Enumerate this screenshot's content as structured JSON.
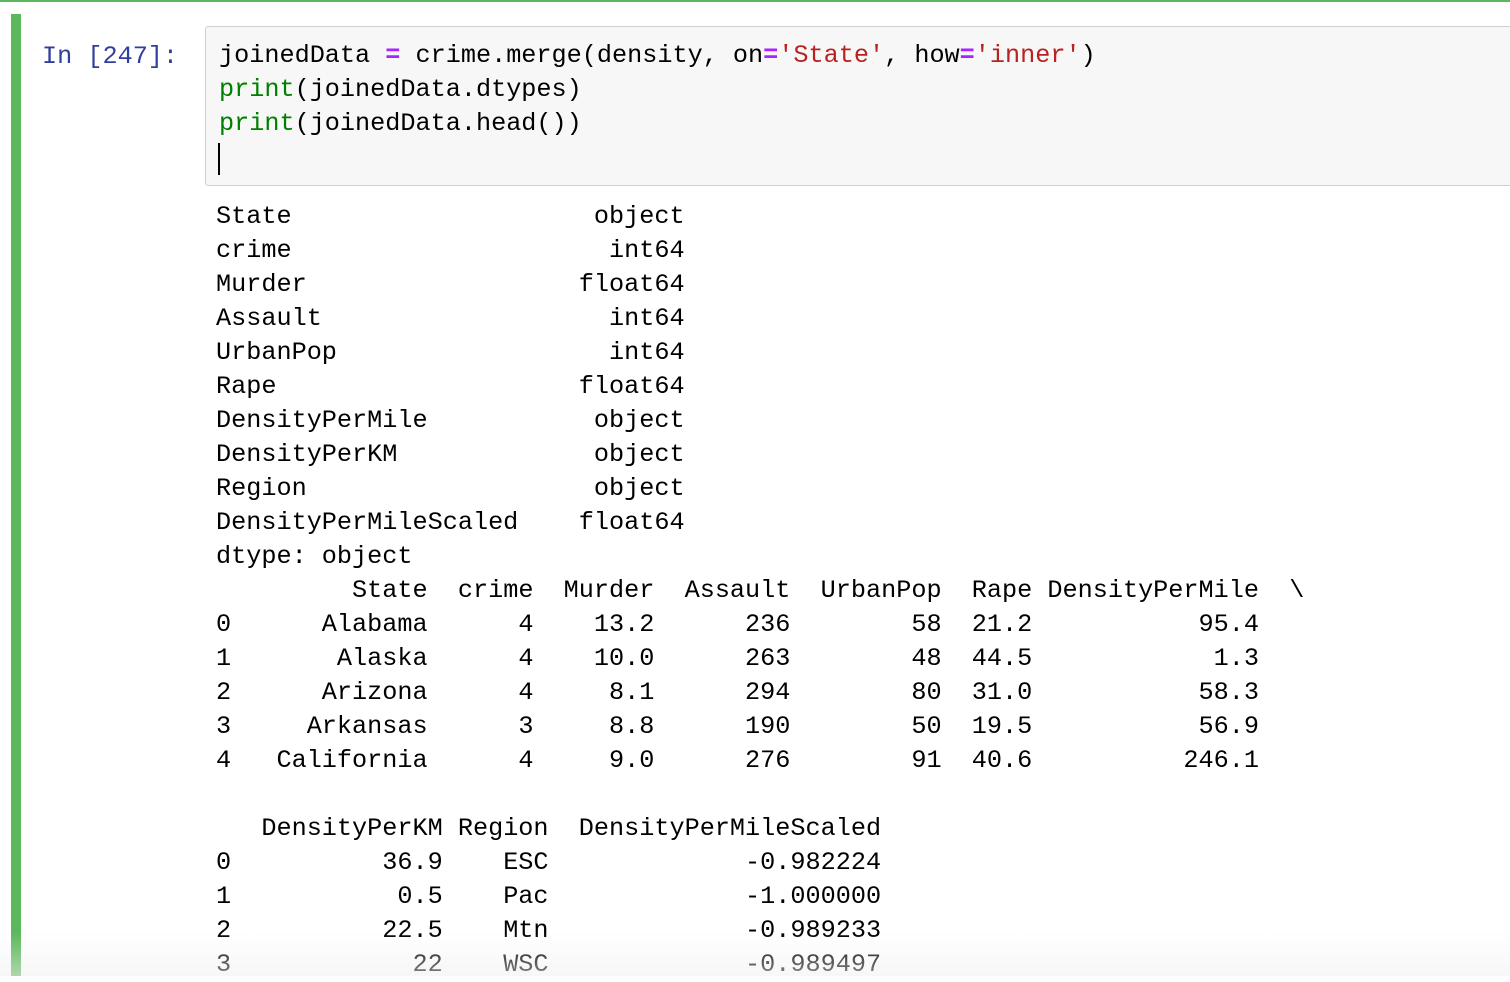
{
  "cell": {
    "prompt": "In [247]:",
    "code_lines": [
      [
        {
          "t": "joinedData ",
          "k": "plain"
        },
        {
          "t": "=",
          "k": "op"
        },
        {
          "t": " crime.merge(density, on",
          "k": "plain"
        },
        {
          "t": "=",
          "k": "op"
        },
        {
          "t": "'State'",
          "k": "str"
        },
        {
          "t": ", how",
          "k": "plain"
        },
        {
          "t": "=",
          "k": "op"
        },
        {
          "t": "'inner'",
          "k": "str"
        },
        {
          "t": ")",
          "k": "plain"
        }
      ],
      [
        {
          "t": "print",
          "k": "fn"
        },
        {
          "t": "(joinedData.dtypes)",
          "k": "plain"
        }
      ],
      [
        {
          "t": "print",
          "k": "fn"
        },
        {
          "t": "(joinedData.head())",
          "k": "plain"
        }
      ]
    ]
  },
  "output": {
    "dtypes": [
      {
        "name": "State",
        "dtype": "object"
      },
      {
        "name": "crime",
        "dtype": "int64"
      },
      {
        "name": "Murder",
        "dtype": "float64"
      },
      {
        "name": "Assault",
        "dtype": "int64"
      },
      {
        "name": "UrbanPop",
        "dtype": "int64"
      },
      {
        "name": "Rape",
        "dtype": "float64"
      },
      {
        "name": "DensityPerMile",
        "dtype": "object"
      },
      {
        "name": "DensityPerKM",
        "dtype": "object"
      },
      {
        "name": "Region",
        "dtype": "object"
      },
      {
        "name": "DensityPerMileScaled",
        "dtype": "float64"
      }
    ],
    "dtype_footer": "dtype: object",
    "table1": {
      "columns": [
        "State",
        "crime",
        "Murder",
        "Assault",
        "UrbanPop",
        "Rape",
        "DensityPerMile"
      ],
      "continuation": "\\",
      "rows": [
        {
          "index": "0",
          "cells": [
            "Alabama",
            "4",
            "13.2",
            "236",
            "58",
            "21.2",
            "95.4"
          ]
        },
        {
          "index": "1",
          "cells": [
            "Alaska",
            "4",
            "10.0",
            "263",
            "48",
            "44.5",
            "1.3"
          ]
        },
        {
          "index": "2",
          "cells": [
            "Arizona",
            "4",
            "8.1",
            "294",
            "80",
            "31.0",
            "58.3"
          ]
        },
        {
          "index": "3",
          "cells": [
            "Arkansas",
            "3",
            "8.8",
            "190",
            "50",
            "19.5",
            "56.9"
          ]
        },
        {
          "index": "4",
          "cells": [
            "California",
            "4",
            "9.0",
            "276",
            "91",
            "40.6",
            "246.1"
          ]
        }
      ]
    },
    "table2": {
      "columns": [
        "DensityPerKM",
        "Region",
        "DensityPerMileScaled"
      ],
      "rows": [
        {
          "index": "0",
          "cells": [
            "36.9",
            "ESC",
            "-0.982224"
          ]
        },
        {
          "index": "1",
          "cells": [
            "0.5",
            "Pac",
            "-1.000000"
          ]
        },
        {
          "index": "2",
          "cells": [
            "22.5",
            "Mtn",
            "-0.989233"
          ]
        },
        {
          "index": "3",
          "cells": [
            "22",
            "WSC",
            "-0.989497"
          ]
        }
      ]
    }
  }
}
